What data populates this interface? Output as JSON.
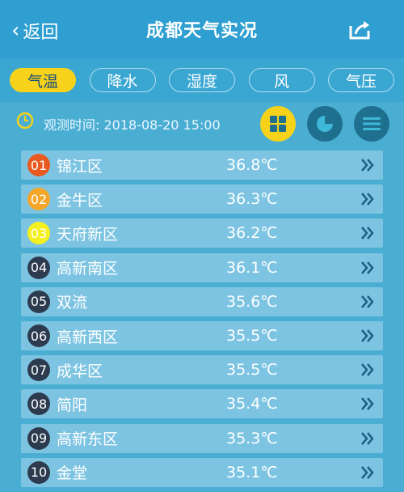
{
  "header": {
    "back_label": "返回",
    "title": "成都天气实况"
  },
  "tabs": [
    {
      "label": "气温",
      "active": true
    },
    {
      "label": "降水",
      "active": false
    },
    {
      "label": "湿度",
      "active": false
    },
    {
      "label": "风",
      "active": false
    },
    {
      "label": "气压",
      "active": false
    }
  ],
  "observation": {
    "time_text": "观测时间: 2018-08-20 15:00"
  },
  "view_buttons": [
    "grid-view",
    "pie-view",
    "list-view"
  ],
  "colors": {
    "header": "#2e9fd0",
    "active_tab": "#f7d21a",
    "rank1": "#e85a1f",
    "rank2": "#f6a72a",
    "rank3": "#f4ef1e",
    "rank_default": "#2d3b4e"
  },
  "rankings": [
    {
      "rank": "01",
      "district": "锦江区",
      "temp": "36.8℃"
    },
    {
      "rank": "02",
      "district": "金牛区",
      "temp": "36.3℃"
    },
    {
      "rank": "03",
      "district": "天府新区",
      "temp": "36.2℃"
    },
    {
      "rank": "04",
      "district": "高新南区",
      "temp": "36.1℃"
    },
    {
      "rank": "05",
      "district": "双流",
      "temp": "35.6℃"
    },
    {
      "rank": "06",
      "district": "高新西区",
      "temp": "35.5℃"
    },
    {
      "rank": "07",
      "district": "成华区",
      "temp": "35.5℃"
    },
    {
      "rank": "08",
      "district": "简阳",
      "temp": "35.4℃"
    },
    {
      "rank": "09",
      "district": "高新东区",
      "temp": "35.3℃"
    },
    {
      "rank": "10",
      "district": "金堂",
      "temp": "35.1℃"
    }
  ]
}
